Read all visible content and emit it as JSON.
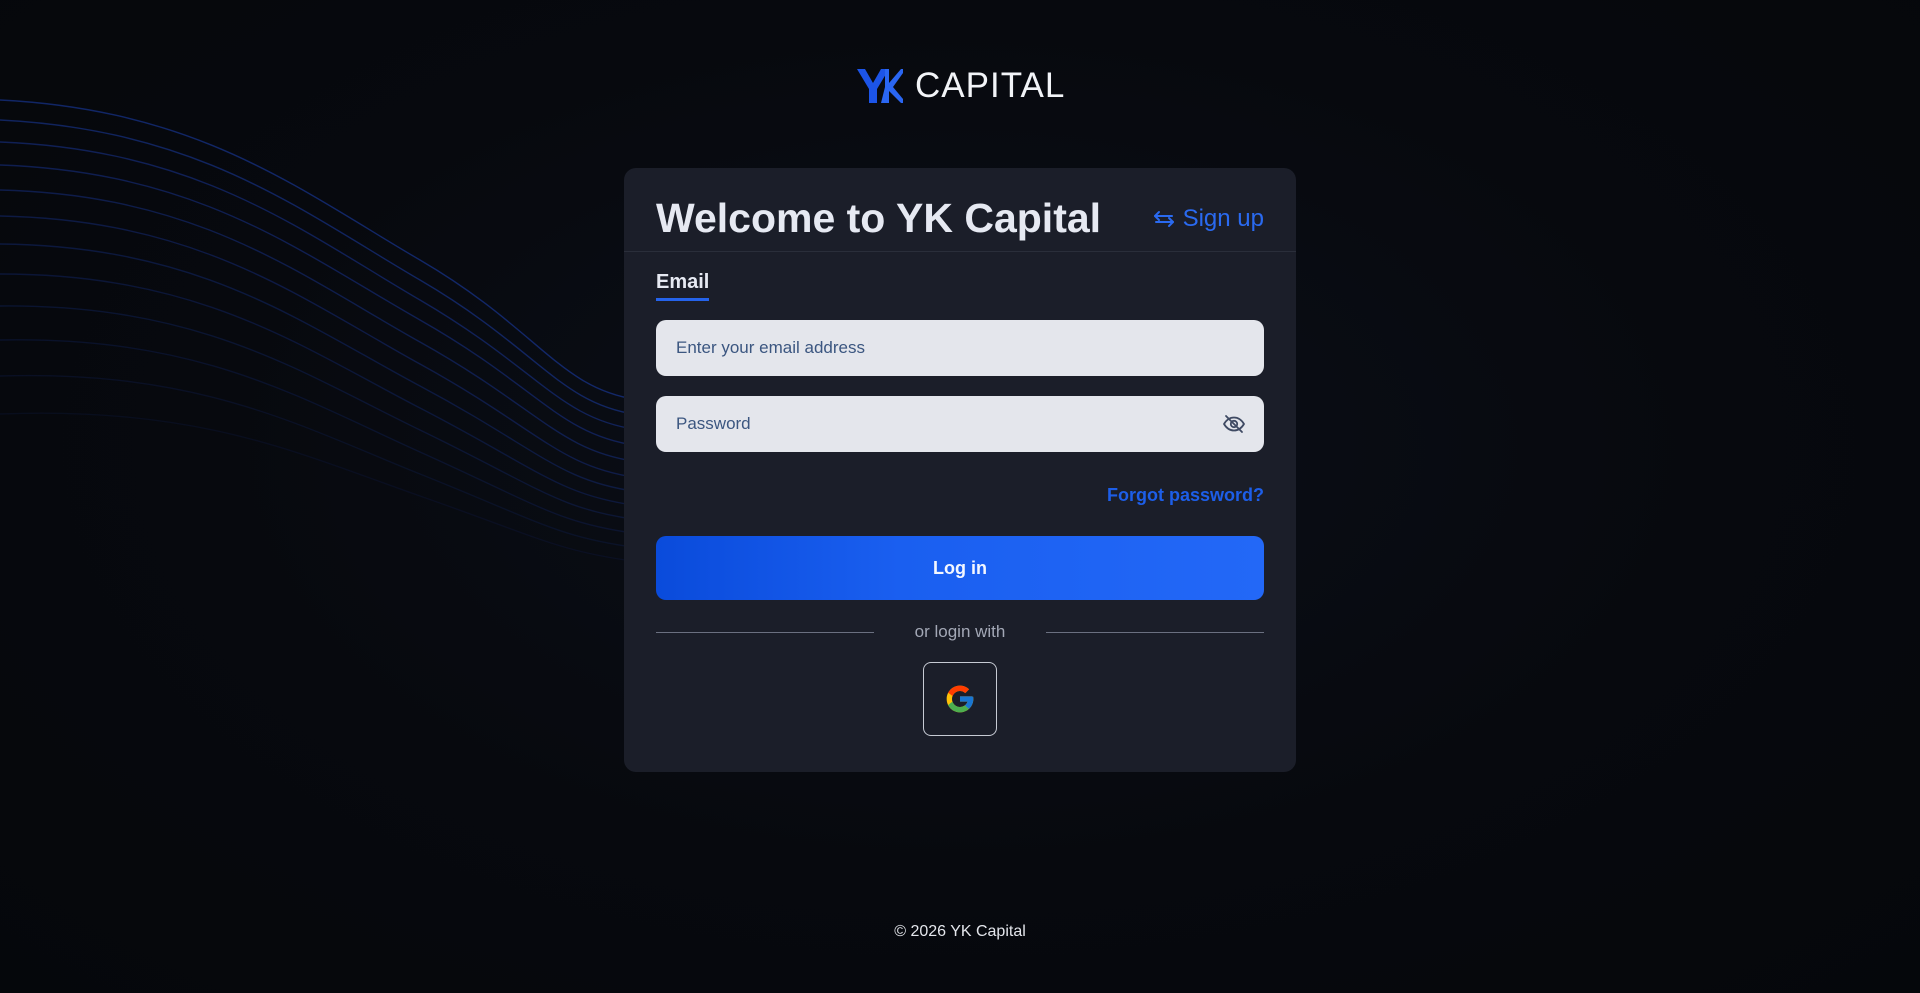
{
  "brand": {
    "logo_mark": "yk-logo-icon",
    "name": "CAPITAL",
    "accent_color": "#2563eb"
  },
  "card": {
    "title": "Welcome to YK Capital",
    "signup_label": "Sign up",
    "signup_icon": "swap-arrows-icon",
    "tab_label": "Email",
    "email_placeholder": "Enter your email address",
    "password_placeholder": "Password",
    "password_toggle_icon": "eye-off-icon",
    "forgot_label": "Forgot password?",
    "login_label": "Log in",
    "divider_label": "or login with",
    "social": [
      {
        "icon": "google-icon"
      }
    ]
  },
  "footer": {
    "copyright": "© 2026 YK Capital"
  },
  "colors": {
    "background": "#06090f",
    "card": "#1b1e29",
    "input": "#e4e6ec",
    "primary_button": "#1a5ff0",
    "link": "#1d5ee8"
  }
}
